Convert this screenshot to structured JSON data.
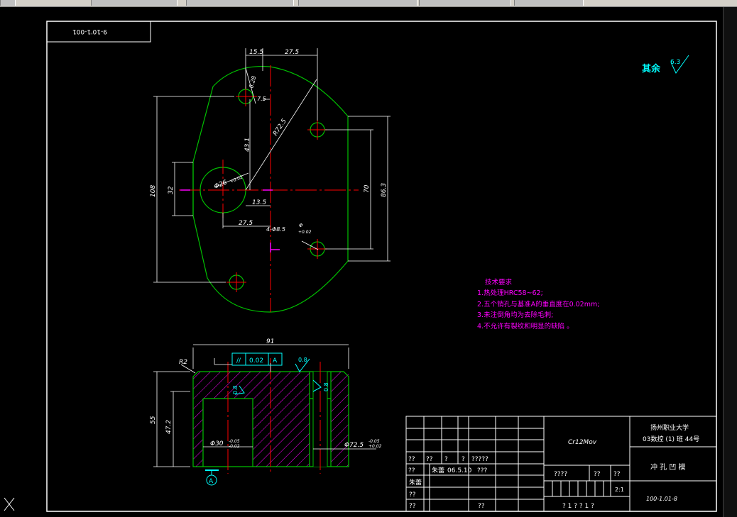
{
  "topbar": {
    "tabs": [
      "",
      "",
      "",
      "",
      "",
      ""
    ]
  },
  "drawing": {
    "top_left_code": "9-10'1-001",
    "surface_note": "其余",
    "surface_note_value": "6.3",
    "tech_title": "技术要求",
    "tech_lines": [
      "1.热处理HRC58~62;",
      "2.五个销孔与基准A的垂直度在0.02mm;",
      "3.未注倒角均为去除毛刺;",
      "4.不允许有裂纹和明显的缺陷 。"
    ],
    "dims": {
      "d15_5": "15.5",
      "d27_5_top": "27.5",
      "d6_28": "6.28",
      "d7_5": "7.5",
      "r72_5": "R72.5",
      "d43_1": "43.1",
      "d108": "108",
      "d32": "32",
      "phi26": "Φ26",
      "phi26_tol": "+0.02",
      "d13_5": "13.5",
      "d27_5": "27.5",
      "phi8_5": "4-Φ8.5",
      "phi_small": "Φ",
      "phi_small_tol": "+0.02",
      "d70": "70",
      "d86_3": "86.3",
      "d91": "91",
      "r2": "R2",
      "tol_par": "//",
      "tol_val": "0.02",
      "tol_ref": "A",
      "ra08_a": "0.8",
      "ra08_b": "0.8",
      "ra08_c": "0.8",
      "d55": "55",
      "d47_2": "47.2",
      "phi30": "Φ30",
      "phi30_tol_u": "-0.05",
      "phi30_tol_l": "-0.02",
      "phi72_5": "Φ72.5",
      "phi72_tol_u": "-0.05",
      "phi72_tol_l": "+0.02",
      "datum_a": "A"
    },
    "title_block": {
      "material": "Cr12Mov",
      "school": "扬州职业大学",
      "class_line": "03数控 (1) 班 44号",
      "part_name": "冲 孔 凹 模",
      "drawing_no": "100-1.01-8",
      "scale_label": "????",
      "q1": "??",
      "q2": "??",
      "ratio": "2:1",
      "bottom_center": "? 1 ?   ? 1 ?",
      "r1": [
        "??",
        "??",
        "?",
        "?",
        "?????"
      ],
      "r2_a": "??",
      "r2_b": "朱蕾",
      "r2_date": "06.5.10",
      "r2_c": "???",
      "r3_a": "朱蕾",
      "r4_a": "??",
      "r5_a": "??",
      "r5_b": "??"
    }
  },
  "colors": {
    "outline": "#00c000",
    "center": "#ff0000",
    "dim": "#ffffff",
    "hatch": "#ff00ff",
    "note": "#00ffff",
    "tech": "#ff00ff",
    "frame": "#ffffff"
  }
}
